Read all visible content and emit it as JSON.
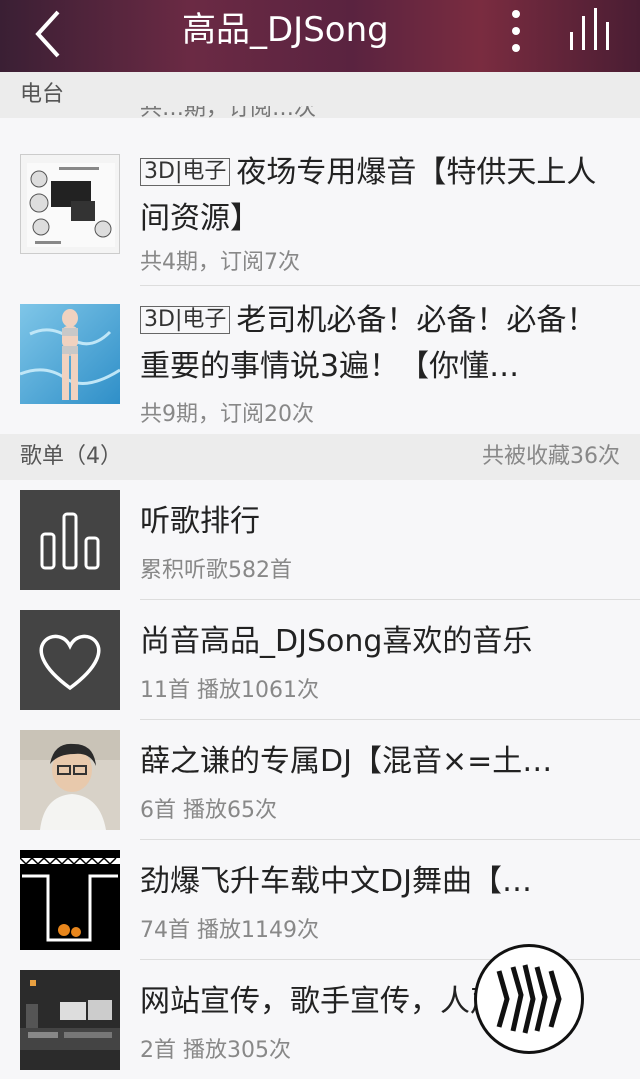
{
  "header": {
    "title": "高品_DJSong"
  },
  "sections": {
    "radio": {
      "label": "电台"
    },
    "playlists": {
      "label": "歌单（4）",
      "summary": "共被收藏36次"
    }
  },
  "partial_prev_text": "共…期，订阅…次",
  "radios": [
    {
      "tag": "3D|电子",
      "title": "夜场专用爆音【特供天上人间资源】",
      "meta": "共4期，订阅7次"
    },
    {
      "tag": "3D|电子",
      "title": "老司机必备！必备！必备！重要的事情说3遍！【你懂…",
      "meta": "共9期，订阅20次"
    }
  ],
  "playlists": [
    {
      "title": "听歌排行",
      "meta": "累积听歌582首",
      "icon": "bar-chart-icon"
    },
    {
      "title": "尚音高品_DJSong喜欢的音乐",
      "meta": "11首 播放1061次",
      "icon": "heart-icon"
    },
    {
      "title": "薛之谦的专属DJ【混音×=土…",
      "meta": "6首 播放65次"
    },
    {
      "title": "劲爆飞升车载中文DJ舞曲【…",
      "meta": "74首 播放1149次"
    },
    {
      "title": "网站宣传，歌手宣传，人声…",
      "meta": "2首 播放305次"
    }
  ],
  "colors": {
    "header": "#5a2340",
    "section_bg": "#ececec",
    "icon_bg": "#444444"
  }
}
